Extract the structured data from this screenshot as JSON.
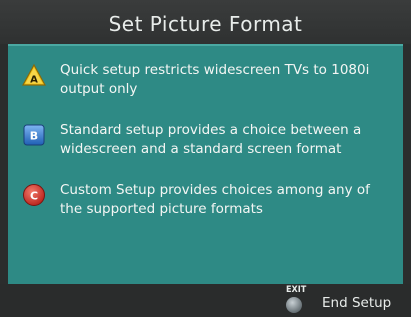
{
  "header": {
    "title": "Set Picture Format"
  },
  "options": [
    {
      "key": "A",
      "icon": "yellow-triangle-a-icon",
      "color": "#f2c31a",
      "text": "Quick setup restricts widescreen TVs to 1080i output only"
    },
    {
      "key": "B",
      "icon": "blue-square-b-icon",
      "color": "#2f7fd8",
      "text": "Standard setup provides a choice between a widescreen and a standard screen format"
    },
    {
      "key": "C",
      "icon": "red-circle-c-icon",
      "color": "#d8322a",
      "text": "Custom Setup provides choices among any of the supported picture formats"
    }
  ],
  "footer": {
    "exit_label": "EXIT",
    "end_label": "End Setup"
  },
  "colors": {
    "content_bg": "#2e8a85",
    "chrome_bg": "#2b2d2d",
    "text": "#f4f6f4"
  }
}
